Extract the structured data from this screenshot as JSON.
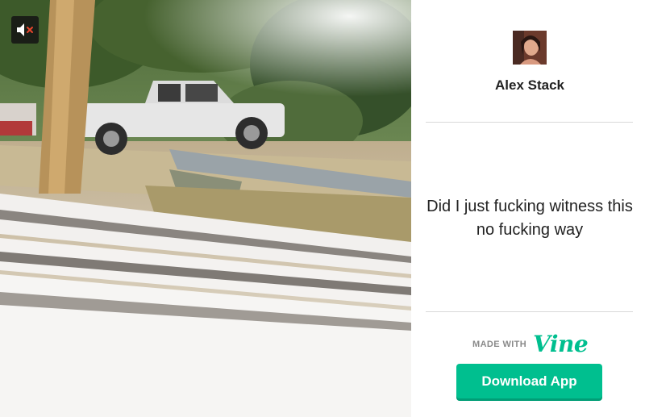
{
  "video": {
    "mute_icon": "muted-speaker-icon"
  },
  "author": {
    "name": "Alex Stack",
    "avatar_icon": "user-avatar"
  },
  "post": {
    "caption": "Did I just fucking witness this no fucking way"
  },
  "footer": {
    "made_with_label": "MADE WITH",
    "brand_logo": "Vine",
    "download_label": "Download App"
  },
  "colors": {
    "vine_green": "#00bf8f",
    "mute_x": "#e8452c"
  }
}
